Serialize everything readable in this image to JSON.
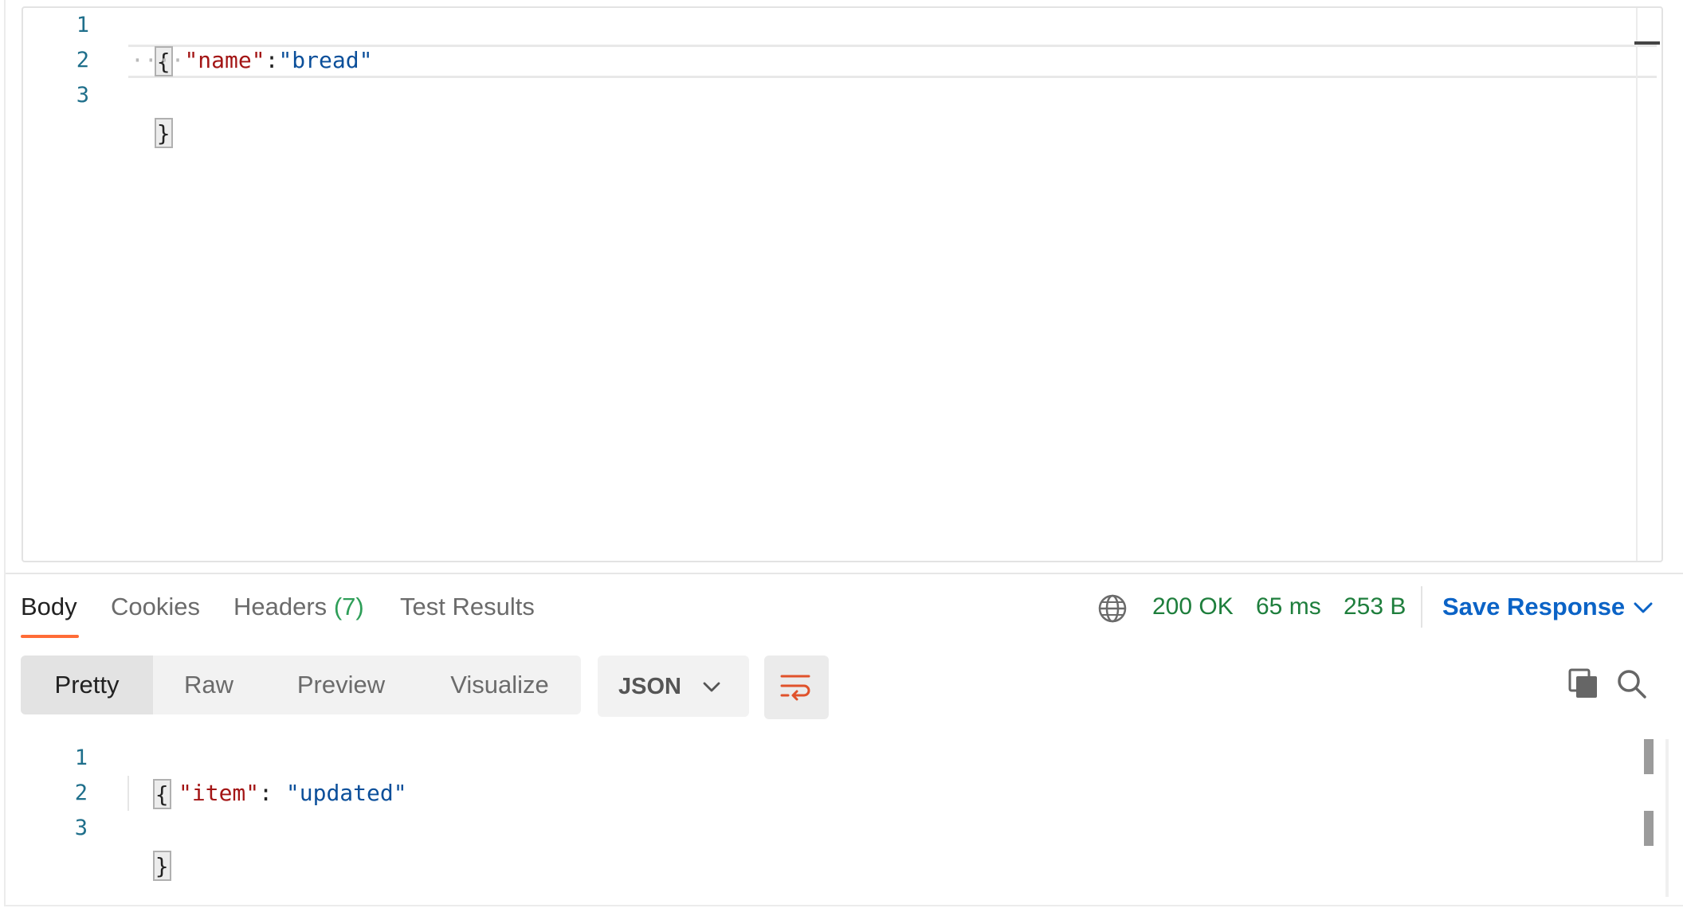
{
  "request_body": {
    "line_numbers": [
      "1",
      "2",
      "3"
    ],
    "open_brace": "{",
    "indent_dots": "····",
    "key": "\"name\"",
    "colon": ":",
    "value": "\"bread\"",
    "close_brace": "}"
  },
  "response_tabs": {
    "body": "Body",
    "cookies": "Cookies",
    "headers": "Headers",
    "headers_count": "(7)",
    "test_results": "Test Results"
  },
  "response_status": {
    "status": "200 OK",
    "time": "65 ms",
    "size": "253 B",
    "save_label": "Save Response"
  },
  "view_modes": {
    "pretty": "Pretty",
    "raw": "Raw",
    "preview": "Preview",
    "visualize": "Visualize",
    "format": "JSON"
  },
  "response_body": {
    "line_numbers": [
      "1",
      "2",
      "3"
    ],
    "open_brace": "{",
    "key": "\"item\"",
    "colon": ": ",
    "value": "\"updated\"",
    "close_brace": "}"
  },
  "icons": {
    "globe": "globe-icon",
    "chevron": "chevron-down-icon",
    "wrap": "wrap-lines-icon",
    "copy": "copy-icon",
    "search": "search-icon"
  },
  "colors": {
    "accent_orange": "#ff6c37",
    "status_green": "#1e7e3c",
    "link_blue": "#0b63c6",
    "json_key": "#a31515",
    "json_string": "#0b4f9a"
  }
}
